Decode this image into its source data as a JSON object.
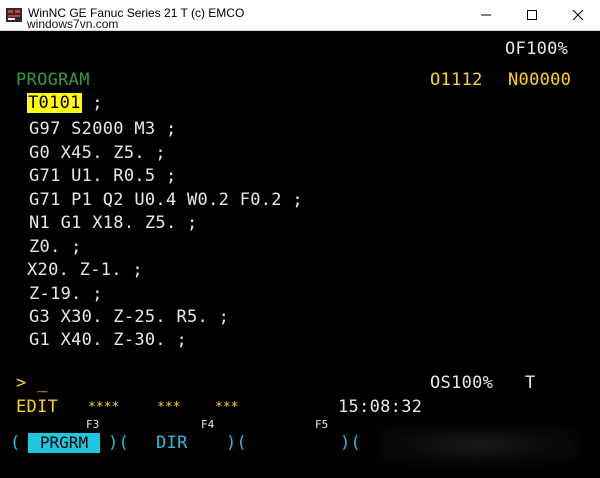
{
  "window": {
    "title": "WinNC GE Fanuc Series 21 T (c) EMCO",
    "watermark": "windows7vn.com",
    "controls": {
      "minimize_icon": "minimize-icon",
      "maximize_icon": "maximize-icon",
      "close_icon": "close-icon"
    }
  },
  "screen": {
    "override_top": "OF100%",
    "mode_title": "PROGRAM",
    "program_number": "O1112",
    "sequence_number": "N00000",
    "program_lines": [
      {
        "highlight": "T0101",
        "rest": " ;"
      },
      {
        "text": "G97 S2000 M3 ;"
      },
      {
        "text": "G0 X45. Z5. ;"
      },
      {
        "text": "G71 U1. R0.5 ;"
      },
      {
        "text": "G71 P1 Q2 U0.4 W0.2 F0.2 ;"
      },
      {
        "text": "N1 G1 X18. Z5. ;"
      },
      {
        "text": "Z0. ;"
      },
      {
        "text": "X20. Z-1. ;"
      },
      {
        "text": "Z-19. ;"
      },
      {
        "text": "G3 X30. Z-25. R5. ;"
      },
      {
        "text": "G1 X40. Z-30. ;"
      }
    ],
    "input_prompt": "> _",
    "override_spindle": "OS100%",
    "tool_status": "T",
    "status_mode": "EDIT",
    "status_fields": [
      "****",
      "***",
      "***"
    ],
    "clock": "15:08:32",
    "softkey_fkeys": [
      "F3",
      "F4",
      "F5"
    ],
    "softkeys": {
      "open1": "(",
      "prgrm": "PRGRM",
      "sep1": ")(",
      "dir": "DIR",
      "sep2": ")(",
      "sep3": ")("
    }
  },
  "colors": {
    "background": "#000000",
    "text": "#e8e8e8",
    "green": "#3a9a3a",
    "yellow": "#ffd21a",
    "cyan": "#22bfe0",
    "highlight": "#ffff00"
  }
}
